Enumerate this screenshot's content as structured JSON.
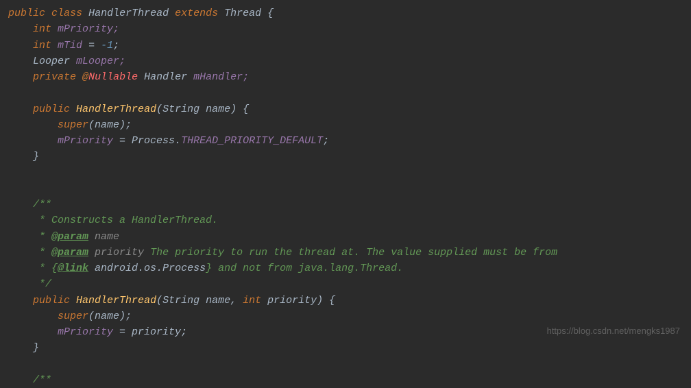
{
  "code": {
    "l1_public": "public",
    "l1_class": "class",
    "l1_HandlerThread": "HandlerThread",
    "l1_extends": "extends",
    "l1_Thread": "Thread",
    "l1_brace": " {",
    "l2_int": "int",
    "l2_mPriority_semi": "mPriority;",
    "l3_int": "int",
    "l3_mTid": "mTid",
    "l3_eq": " = ",
    "l3_neg1": "-1",
    "l3_semi": ";",
    "l4_Looper": "Looper",
    "l4_mLooper_semi": "mLooper;",
    "l5_private": "private",
    "l5_at": "@",
    "l5_Nullable": "Nullable",
    "l5_Handler": "Handler",
    "l5_mHandler_semi": "mHandler;",
    "l7_public": "public",
    "l7_HandlerThread": "HandlerThread",
    "l7_lp": "(",
    "l7_String": "String",
    "l7_name_rp_b": " name) {",
    "l8_super": "super",
    "l8_name": "(name);",
    "l9_mPriority": "mPriority",
    "l9_eq": " = ",
    "l9_Process": "Process.",
    "l9_const": "THREAD_PRIORITY_DEFAULT",
    "l9_semi": ";",
    "l10_brace": "}",
    "l13_c": "/**",
    "l14_c": " * Constructs a HandlerThread.",
    "l15_star": " * ",
    "l15_param": "@param",
    "l15_name": " name",
    "l16_star": " * ",
    "l16_param": "@param",
    "l16_priority": " priority",
    "l16_text": " The priority to run the thread at. The value supplied must be from",
    "l17_star": " * {",
    "l17_link": "@link",
    "l17_pkg": " android.os.Process",
    "l17_text": "} and not from java.lang.Thread.",
    "l18_c": " */",
    "l19_public": "public",
    "l19_HandlerThread": "HandlerThread",
    "l19_lp": "(",
    "l19_String": "String",
    "l19_name_c": " name, ",
    "l19_int": "int",
    "l19_priority_rp_b": " priority) {",
    "l20_super": "super",
    "l20_name": "(name);",
    "l21_mPriority": "mPriority",
    "l21_eq": " = priority;",
    "l22_brace": "}",
    "l24_c": "/**"
  },
  "watermark": "https://blog.csdn.net/mengks1987"
}
